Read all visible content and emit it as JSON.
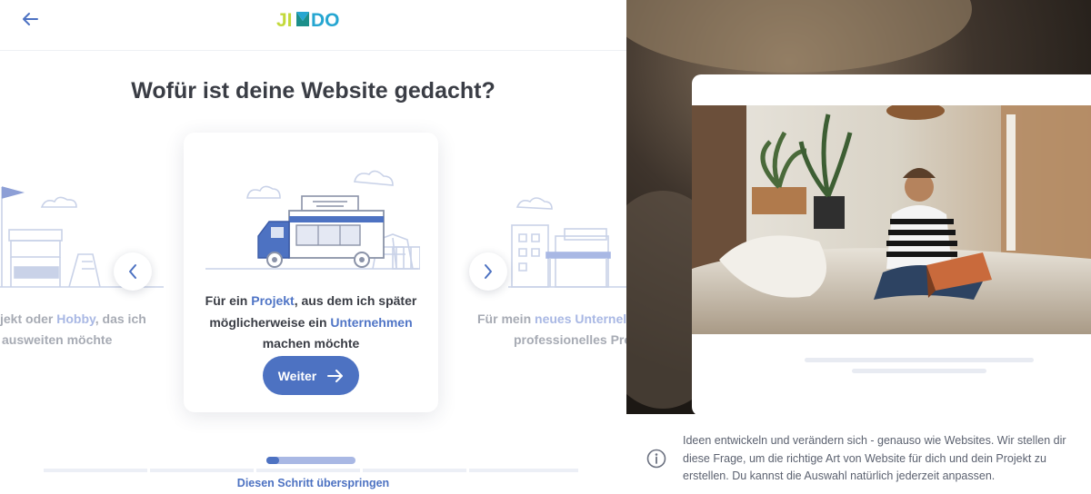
{
  "header": {
    "logo_text": "JIMDO",
    "back_icon": "arrow-left-icon"
  },
  "question": "Wofür ist deine Website gedacht?",
  "cards": {
    "left_partial": {
      "line1_prefix": "jekt oder ",
      "line1_hl": "Hobby",
      "line1_suffix": ", das ich",
      "line2": "ausweiten möchte"
    },
    "active": {
      "p1": "Für ein ",
      "hl1": "Projekt",
      "p2": ", aus dem ich später",
      "p3": "möglicherweise ein ",
      "hl2": "Unternehmen",
      "p4": "machen möchte",
      "button_label": "Weiter"
    },
    "right_partial": {
      "line1_prefix": "Für mein ",
      "line1_hl": "neues Unternel",
      "line2": "professionelles Pro"
    }
  },
  "skip_label": "Diesen Schritt überspringen",
  "info": {
    "text": "Ideen entwickeln und verändern sich - genauso wie Websites. Wir stellen dir diese Frage, um die richtige Art von Website für dich und dein Projekt zu erstellen. Du kannst die Auswahl natürlich jederzeit anpassen."
  },
  "colors": {
    "accent": "#4d72c2",
    "highlight": "#5075c6",
    "text": "#3a3d45",
    "muted": "#a7abb4"
  },
  "progress": {
    "active_step": 1,
    "total_steps": 3
  }
}
